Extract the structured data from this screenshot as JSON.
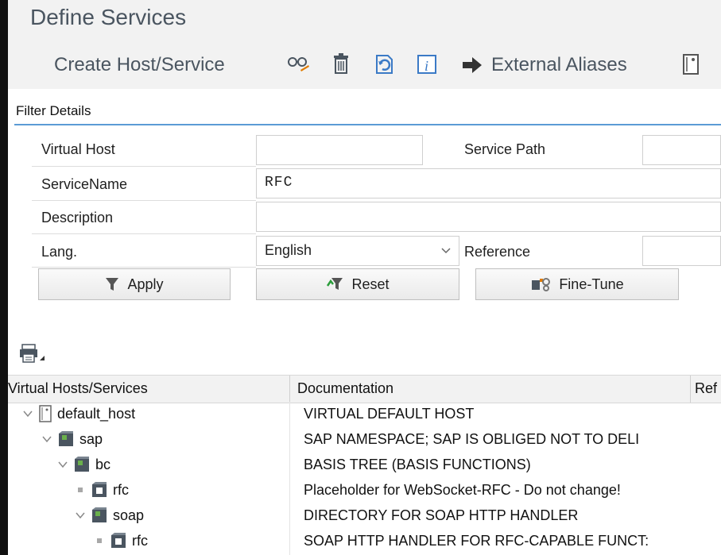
{
  "header": {
    "title": "Define Services"
  },
  "toolbar": {
    "create_label": "Create Host/Service",
    "external_aliases_label": "External Aliases"
  },
  "filter": {
    "section_title": "Filter Details",
    "virtual_host_label": "Virtual Host",
    "virtual_host_value": "",
    "service_path_label": "Service Path",
    "service_path_value": "",
    "service_name_label": "ServiceName",
    "service_name_value": "RFC",
    "description_label": "Description",
    "description_value": "",
    "lang_label": "Lang.",
    "lang_value": "English",
    "reference_label": "Reference",
    "reference_value": "",
    "apply_label": "Apply",
    "reset_label": "Reset",
    "finetune_label": "Fine-Tune"
  },
  "grid": {
    "col_hosts": "Virtual Hosts/Services",
    "col_doc": "Documentation",
    "col_ref": "Ref",
    "rows": [
      {
        "name": "default_host",
        "doc": "VIRTUAL DEFAULT HOST",
        "icon": "host-icon"
      },
      {
        "name": "sap",
        "doc": "SAP NAMESPACE; SAP IS OBLIGED NOT TO DELI",
        "icon": "package-icon"
      },
      {
        "name": "bc",
        "doc": "BASIS TREE (BASIS FUNCTIONS)",
        "icon": "package-icon"
      },
      {
        "name": "rfc",
        "doc": "Placeholder for WebSocket-RFC - Do not change!",
        "icon": "service-icon"
      },
      {
        "name": "soap",
        "doc": "DIRECTORY FOR SOAP HTTP HANDLER",
        "icon": "package-icon"
      },
      {
        "name": "rfc",
        "doc": "SOAP HTTP HANDLER FOR RFC-CAPABLE FUNCT:",
        "icon": "service-icon"
      }
    ]
  }
}
